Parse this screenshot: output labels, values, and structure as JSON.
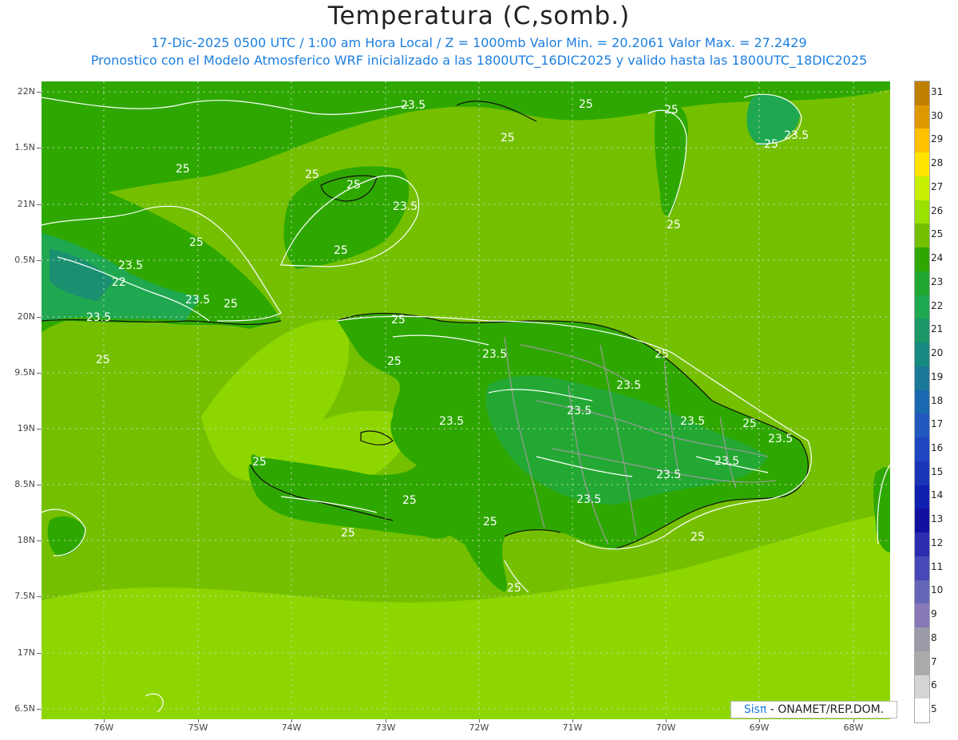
{
  "title": "Temperatura (C,somb.)",
  "subtitle_line1": "17-Dic-2025  0500 UTC / 1:00 am Hora Local / Z = 1000mb    Valor Min. = 20.2061  Valor Max. = 27.2429",
  "subtitle_line2": "Pronostico con el Modelo Atmosferico WRF inicializado a las 1800UTC_16DIC2025 y valido hasta las  1800UTC_18DIC2025",
  "lat_labels": [
    "22N",
    "1.5N",
    "21N",
    "0.5N",
    "20N",
    "9.5N",
    "19N",
    "8.5N",
    "18N",
    "7.5N",
    "17N",
    "6.5N"
  ],
  "lon_labels": [
    "76W",
    "75W",
    "74W",
    "73W",
    "72W",
    "71W",
    "70W",
    "69W",
    "68W"
  ],
  "legend": {
    "labels": [
      "31",
      "30",
      "29",
      "28",
      "27",
      "26",
      "25",
      "24",
      "23",
      "22",
      "21",
      "20",
      "19",
      "18",
      "17",
      "16",
      "15",
      "14",
      "13",
      "12",
      "11",
      "10",
      "9",
      "8",
      "7",
      "6",
      "5"
    ],
    "colors": [
      "#c08000",
      "#e09800",
      "#ffc000",
      "#ffe400",
      "#c6f000",
      "#9ae000",
      "#74c000",
      "#2ea800",
      "#20a830",
      "#1ea850",
      "#1a9868",
      "#168a80",
      "#1a7898",
      "#1a68b0",
      "#2258c0",
      "#1e46c0",
      "#1a34b8",
      "#1020b0",
      "#1010a0",
      "#2c2cb0",
      "#4848b8",
      "#6666b8",
      "#8878b8",
      "#9a9aa8",
      "#aaaaaa",
      "#d4d4d4",
      "#ffffff"
    ]
  },
  "contour_labels": [
    "25",
    "23.5",
    "22"
  ],
  "credit": {
    "brand": "Sisπ",
    "text": "- ONAMET/REP.DOM."
  },
  "colors": {
    "land": "#2ea800",
    "sea": "#74c000",
    "warm_sea": "#8ed600",
    "cool": "#20a850",
    "coldest": "#1a9070"
  }
}
